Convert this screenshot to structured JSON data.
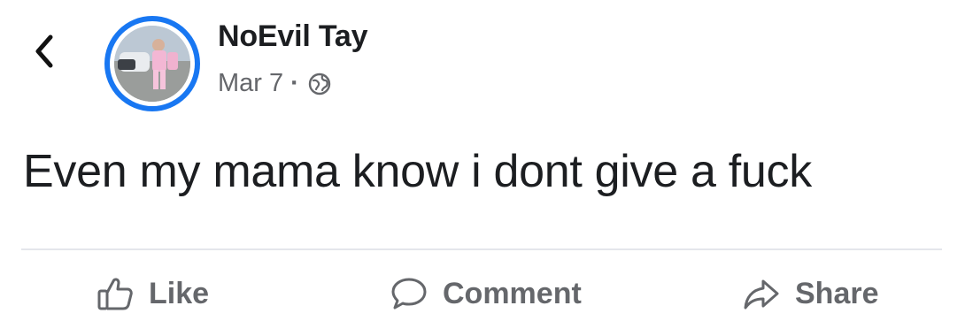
{
  "post": {
    "author_name": "NoEvil Tay",
    "date": "Mar 7",
    "separator": "·",
    "privacy_icon": "globe-icon",
    "text": "Even my mama know i dont give a fuck"
  },
  "header": {
    "back_icon": "chevron-left-icon"
  },
  "actions": {
    "like_label": "Like",
    "comment_label": "Comment",
    "share_label": "Share"
  },
  "colors": {
    "text_primary": "#1c1e21",
    "text_secondary": "#65676b",
    "avatar_ring": "#1877f2",
    "divider": "#e4e6eb"
  }
}
